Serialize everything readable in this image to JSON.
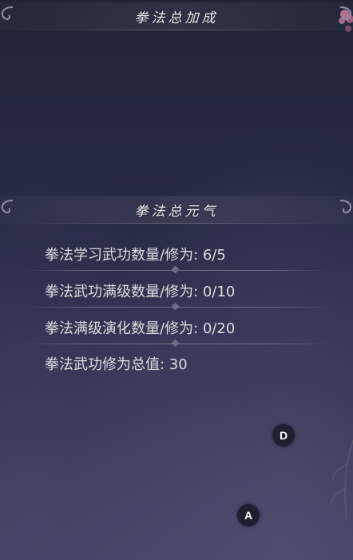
{
  "headers": {
    "top_title": "拳法总加成",
    "mid_title": "拳法总元气"
  },
  "stats": [
    {
      "label": "拳法学习武功数量/修为: 6/5"
    },
    {
      "label": "拳法武功满级数量/修为: 0/10"
    },
    {
      "label": "拳法满级演化数量/修为: 0/20"
    },
    {
      "label": "拳法武功修为总值: 30"
    }
  ],
  "buttons": {
    "d_label": "D",
    "a_label": "A"
  },
  "colors": {
    "background_top": "#1f2335",
    "background_bottom": "#3a3c5e",
    "text": "#dcdbe0",
    "button_bg": "#1d2030"
  }
}
